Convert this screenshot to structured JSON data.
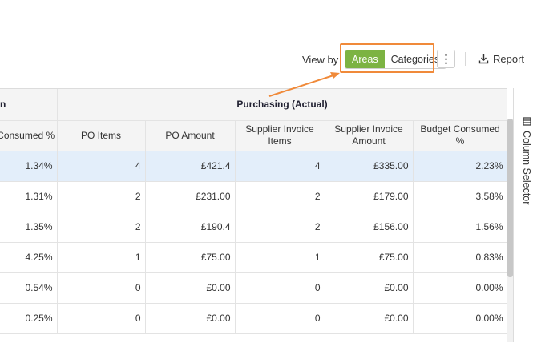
{
  "toolbar": {
    "view_by_label": "View by",
    "view_options": [
      "Areas",
      "Categories"
    ],
    "selected_view": "Areas",
    "more_icon": "⋮",
    "report_label": "Report"
  },
  "table": {
    "left_group_partial": "n",
    "purchasing_group": "Purchasing (Actual)",
    "headers": {
      "left_partial": "Budget Consumed %",
      "po_items": "PO Items",
      "po_amount": "PO Amount",
      "supplier_invoice_items": "Supplier Invoice Items",
      "supplier_invoice_amount": "Supplier Invoice Amount",
      "budget_consumed": "Budget Consumed %"
    },
    "rows": [
      {
        "left_consumed": "1.34%",
        "po_items": "4",
        "po_amount": "£421.4",
        "si_items": "4",
        "si_amount": "£335.00",
        "budget": "2.23%"
      },
      {
        "left_consumed": "1.31%",
        "po_items": "2",
        "po_amount": "£231.00",
        "si_items": "2",
        "si_amount": "£179.00",
        "budget": "3.58%"
      },
      {
        "left_consumed": "1.35%",
        "po_items": "2",
        "po_amount": "£190.4",
        "si_items": "2",
        "si_amount": "£156.00",
        "budget": "1.56%"
      },
      {
        "left_consumed": "4.25%",
        "po_items": "1",
        "po_amount": "£75.00",
        "si_items": "1",
        "si_amount": "£75.00",
        "budget": "0.83%"
      },
      {
        "left_consumed": "0.54%",
        "po_items": "0",
        "po_amount": "£0.00",
        "si_items": "0",
        "si_amount": "£0.00",
        "budget": "0.00%"
      },
      {
        "left_consumed": "0.25%",
        "po_items": "0",
        "po_amount": "£0.00",
        "si_items": "0",
        "si_amount": "£0.00",
        "budget": "0.00%"
      }
    ]
  },
  "column_selector": {
    "label": "Column Selector",
    "icon": "columns-icon"
  },
  "colors": {
    "accent_green": "#7cb342",
    "highlight_orange": "#f08a3a",
    "selected_row": "#e3eefa"
  }
}
